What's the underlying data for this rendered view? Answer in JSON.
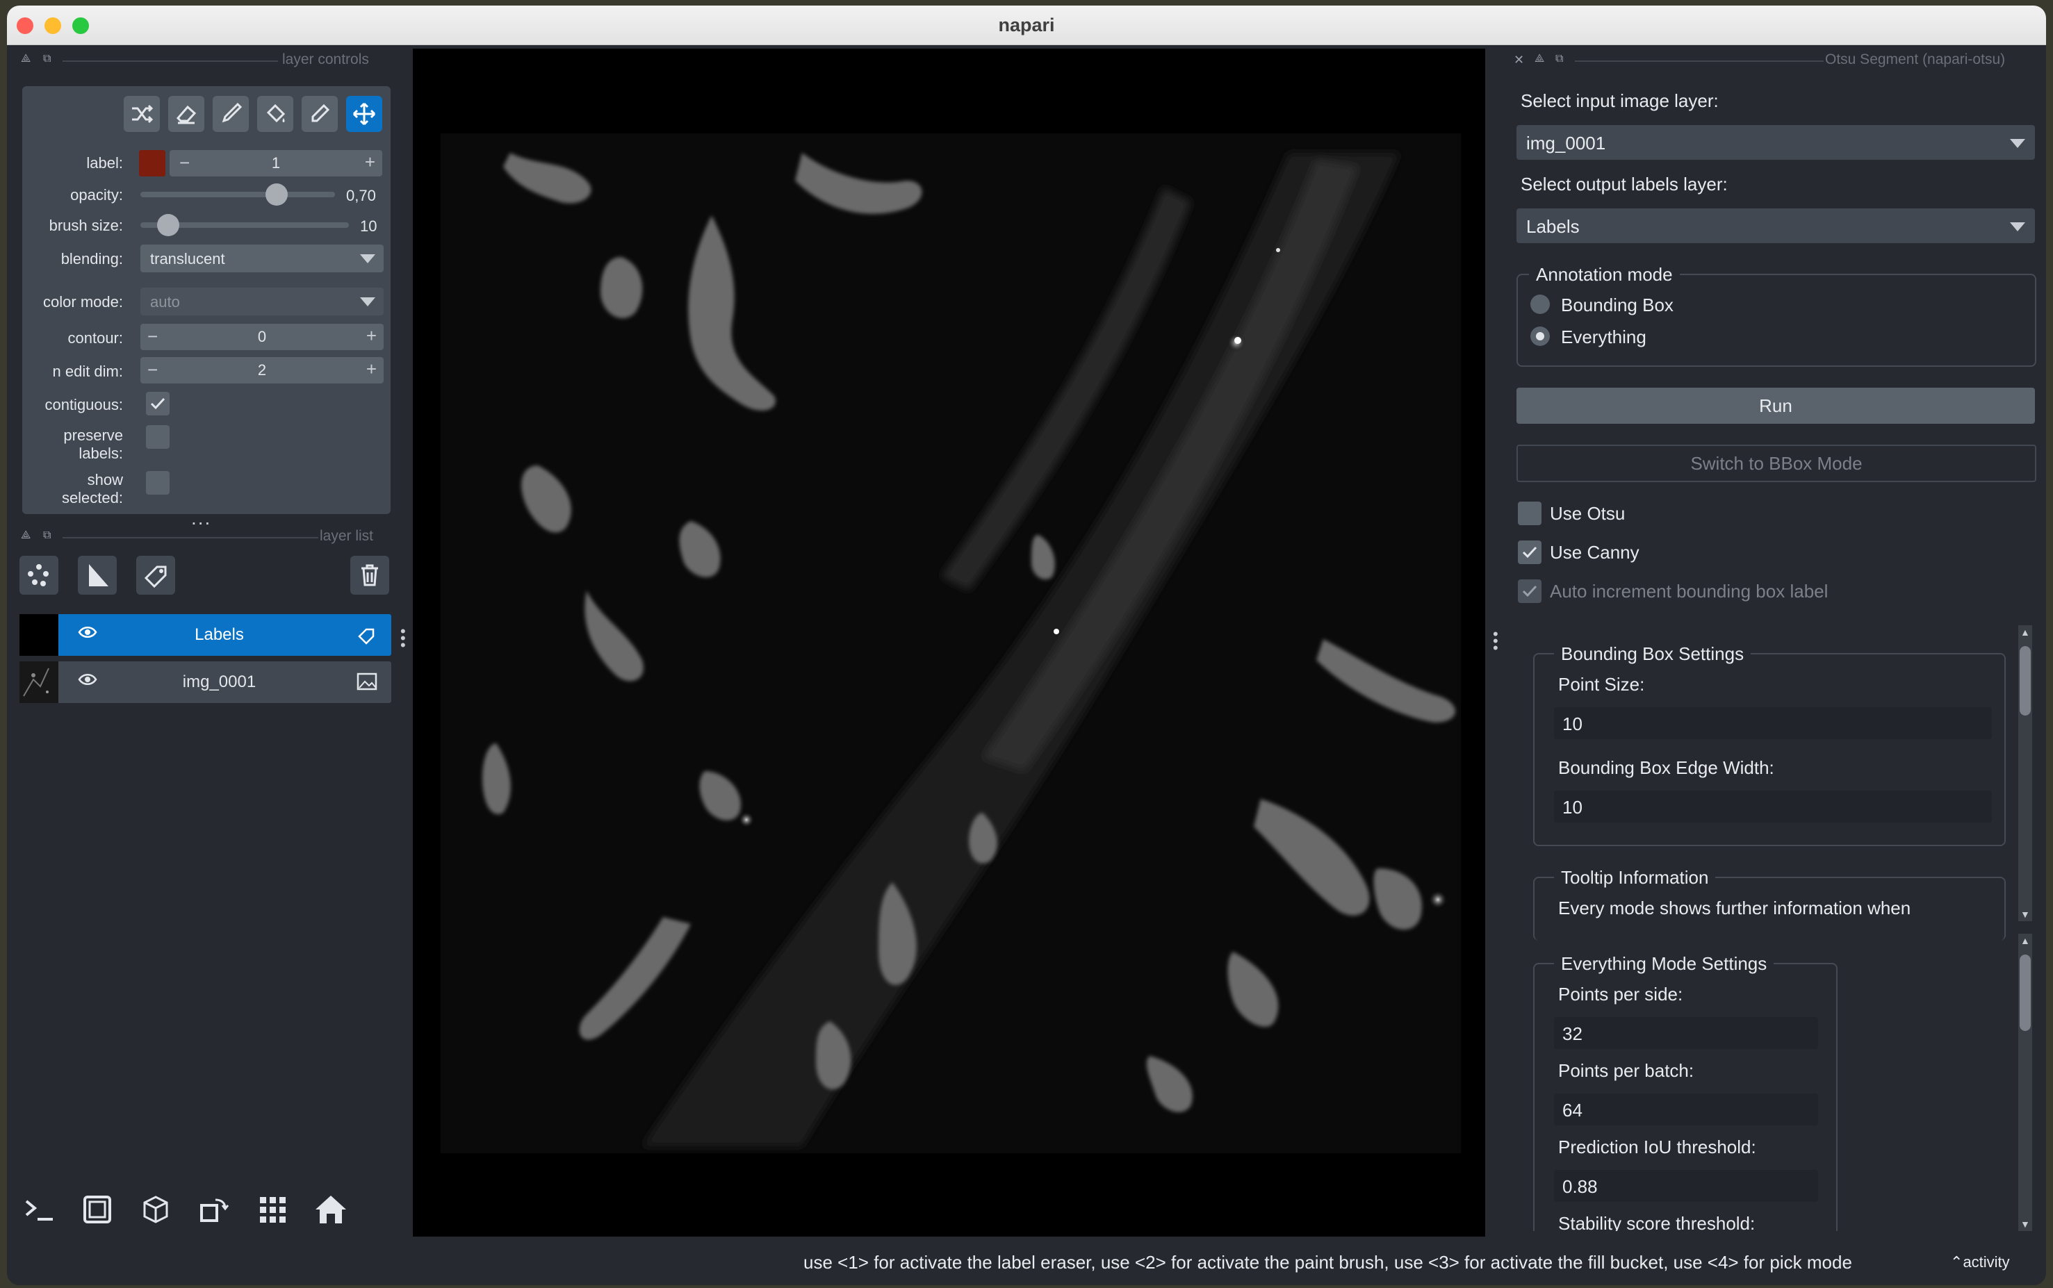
{
  "window": {
    "title": "napari",
    "close_color": "#fe5f57",
    "minimize_color": "#febc2e",
    "zoom_color": "#28c840"
  },
  "layer_controls": {
    "header": "layer controls",
    "tools": [
      {
        "icon": "shuffle-icon"
      },
      {
        "icon": "eraser-icon"
      },
      {
        "icon": "paint-brush-icon"
      },
      {
        "icon": "fill-bucket-icon"
      },
      {
        "icon": "color-picker-icon"
      },
      {
        "icon": "pan-zoom-icon",
        "active": true
      }
    ],
    "label": {
      "name": "label:",
      "value": "1",
      "swatch_color": "#7d1d0e"
    },
    "opacity": {
      "name": "opacity:",
      "value": "0,70",
      "level": 0.7
    },
    "brush_size": {
      "name": "brush size:",
      "value": "10",
      "level": 0.1
    },
    "blending": {
      "name": "blending:",
      "value": "translucent"
    },
    "color_mode": {
      "name": "color mode:",
      "value": "auto"
    },
    "contour": {
      "name": "contour:",
      "value": "0"
    },
    "n_edit_dim": {
      "name": "n edit dim:",
      "value": "2"
    },
    "contiguous": {
      "name": "contiguous:",
      "checked": true
    },
    "preserve_labels": {
      "name_line1": "preserve",
      "name_line2": "labels:",
      "checked": false
    },
    "show_selected": {
      "name_line1": "show",
      "name_line2": "selected:",
      "checked": false
    },
    "more": "..."
  },
  "layer_list": {
    "header": "layer list",
    "layers": [
      {
        "name": "Labels",
        "selected": true,
        "type_icon": "label-tag-icon"
      },
      {
        "name": "img_0001",
        "selected": false,
        "type_icon": "image-icon"
      }
    ]
  },
  "plugin": {
    "header": "Otsu Segment (napari-otsu)",
    "input_label": "Select input image layer:",
    "input_value": "img_0001",
    "output_label": "Select output labels layer:",
    "output_value": "Labels",
    "annotation_mode": {
      "title": "Annotation mode",
      "options": [
        "Bounding Box",
        "Everything"
      ],
      "selected": "Everything"
    },
    "run_button": "Run",
    "switch_button": "Switch to BBox Mode",
    "use_otsu": {
      "label": "Use Otsu",
      "checked": false
    },
    "use_canny": {
      "label": "Use Canny",
      "checked": true
    },
    "auto_increment": {
      "label": "Auto increment bounding box label",
      "checked": true
    },
    "bbox_settings": {
      "title": "Bounding Box Settings",
      "point_size_label": "Point Size:",
      "point_size_value": "10",
      "edge_width_label": "Bounding Box Edge Width:",
      "edge_width_value": "10"
    },
    "tooltip": {
      "title": "Tooltip Information",
      "text": "Every mode shows further information when"
    },
    "everything_settings": {
      "title": "Everything Mode Settings",
      "points_per_side_label": "Points per side:",
      "points_per_side_value": "32",
      "points_per_batch_label": "Points per batch:",
      "points_per_batch_value": "64",
      "iou_label": "Prediction IoU threshold:",
      "iou_value": "0.88",
      "stability_label": "Stability score threshold:"
    }
  },
  "status": {
    "message": "use <1> for activate the label eraser, use <2> for activate the paint brush, use <3> for activate the fill bucket, use <4> for pick mode",
    "activity": "activity"
  },
  "viewer_buttons": [
    "console-icon",
    "ndisplay-square-icon",
    "3d-cube-icon",
    "roll-dims-icon",
    "grid-icon",
    "home-icon"
  ],
  "accent_color": "#0a73c5"
}
